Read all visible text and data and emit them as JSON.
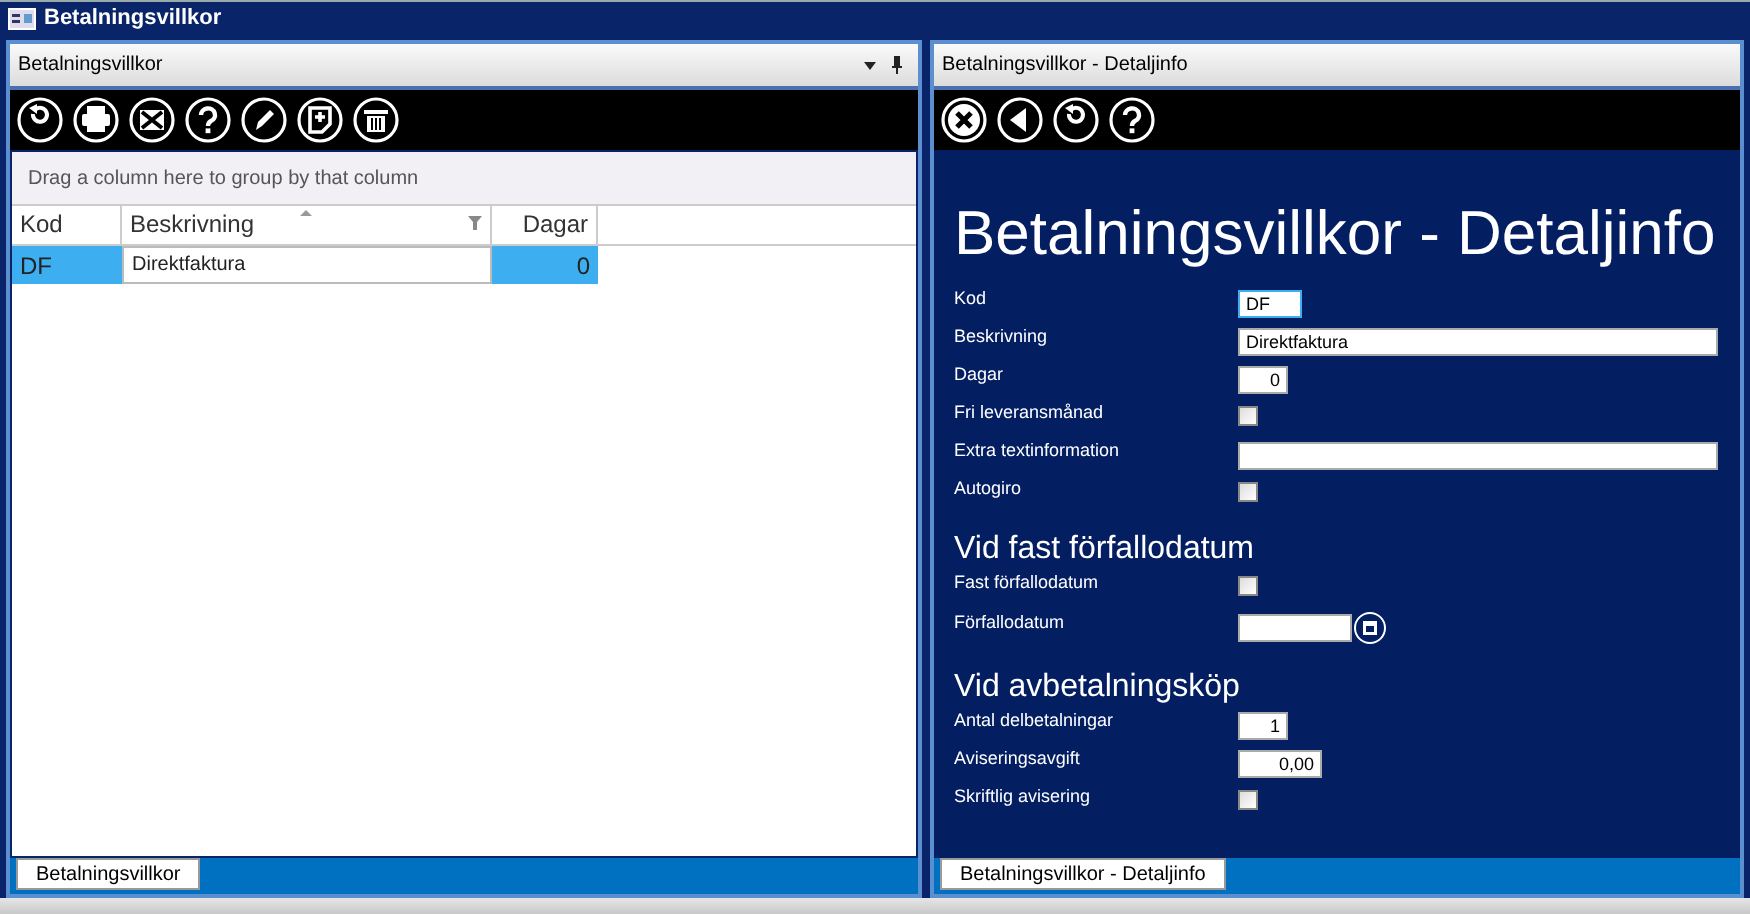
{
  "window": {
    "title": "Betalningsvillkor"
  },
  "left_pane": {
    "title": "Betalningsvillkor",
    "toolbar": [
      {
        "kind": "refresh"
      },
      {
        "kind": "print"
      },
      {
        "kind": "excel"
      },
      {
        "kind": "help"
      },
      {
        "kind": "edit"
      },
      {
        "kind": "new"
      },
      {
        "kind": "delete"
      }
    ],
    "group_hint": "Drag a column here to group by that column",
    "table": {
      "columns": [
        {
          "label": "Kod",
          "kind": "text",
          "sorted": false,
          "filter": false
        },
        {
          "label": "Beskrivning",
          "kind": "text",
          "sorted": true,
          "filter": true
        },
        {
          "label": "Dagar",
          "kind": "number",
          "sorted": false,
          "filter": false
        }
      ],
      "rows": [
        {
          "selected": true,
          "cells": [
            {
              "text": "DF",
              "current": false
            },
            {
              "text": "Direktfaktura",
              "current": true
            },
            {
              "text": "0",
              "current": false
            }
          ]
        }
      ]
    },
    "tab": "Betalningsvillkor"
  },
  "right_pane": {
    "title": "Betalningsvillkor - Detaljinfo",
    "toolbar": [
      {
        "kind": "close"
      },
      {
        "kind": "back"
      },
      {
        "kind": "refresh"
      },
      {
        "kind": "help"
      }
    ],
    "heading": "Betalningsvillkor - Detaljinfo",
    "sections": [
      {
        "fields": [
          {
            "kind": "code",
            "label": "Kod",
            "value": "DF",
            "focused": true
          },
          {
            "kind": "text",
            "label": "Beskrivning",
            "value": "Direktfaktura",
            "focused": false
          },
          {
            "kind": "number",
            "label": "Dagar",
            "value": "0",
            "focused": false
          },
          {
            "kind": "checkbox",
            "label": "Fri leveransmånad",
            "checked": false
          },
          {
            "kind": "text",
            "label": "Extra textinformation",
            "focused": false
          },
          {
            "kind": "checkbox",
            "label": "Autogiro",
            "checked": false
          }
        ]
      },
      {
        "heading": "Vid fast förfallodatum",
        "fields": [
          {
            "kind": "checkbox",
            "label": "Fast förfallodatum",
            "checked": false
          },
          {
            "kind": "date",
            "label": "Förfallodatum"
          }
        ]
      },
      {
        "heading": "Vid avbetalningsköp",
        "fields": [
          {
            "kind": "number",
            "label": "Antal delbetalningar",
            "value": "1",
            "focused": false
          },
          {
            "kind": "amount",
            "label": "Aviseringsavgift",
            "value": "0,00",
            "focused": false
          },
          {
            "kind": "checkbox",
            "label": "Skriftlig avisering",
            "checked": false
          }
        ]
      }
    ],
    "tab": "Betalningsvillkor - Detaljinfo"
  }
}
